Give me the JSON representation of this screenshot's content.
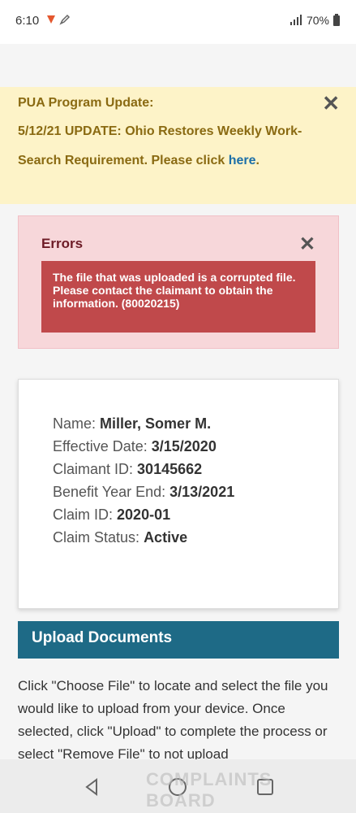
{
  "status_bar": {
    "time": "6:10",
    "battery": "70%"
  },
  "banner": {
    "line1": "PUA Program Update:",
    "line2": "5/12/21 UPDATE: Ohio Restores Weekly Work-",
    "line3_prefix": "Search Requirement. Please click ",
    "line3_link": "here",
    "line3_suffix": "."
  },
  "errors": {
    "title": "Errors",
    "message": "The file that was uploaded is a corrupted file. Please contact the claimant to obtain the information. (80020215)"
  },
  "claim_card": {
    "name_label": "Name:",
    "name_value": "Miller, Somer M.",
    "effective_label": "Effective Date:",
    "effective_value": "3/15/2020",
    "claimant_label": "Claimant ID:",
    "claimant_value": "30145662",
    "benefit_label": "Benefit Year End:",
    "benefit_value": "3/13/2021",
    "claimid_label": "Claim ID:",
    "claimid_value": "2020-01",
    "status_label": "Claim Status:",
    "status_value": "Active"
  },
  "upload": {
    "title": "Upload Documents",
    "instructions": "Click \"Choose File\" to locate and select the file you would like to upload from your device. Once selected, click \"Upload\" to complete the process or select \"Remove File\" to not upload"
  },
  "watermark": {
    "text": "COMPLAINTS BOARD"
  },
  "icons": {
    "close": "close-icon",
    "back": "back-icon",
    "home": "home-icon",
    "recents": "recents-icon"
  }
}
